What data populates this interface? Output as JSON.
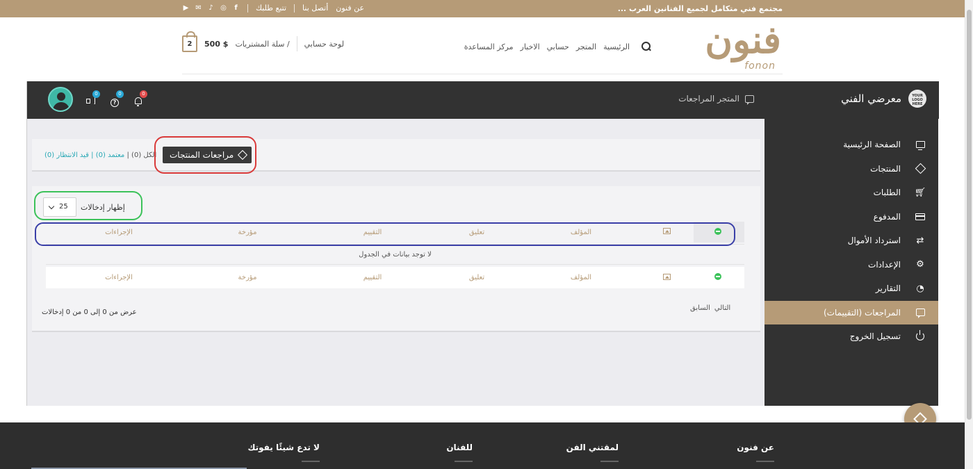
{
  "topbar": {
    "tagline": "مجتمع فني متكامل لجميع الفنانين العرب ...",
    "about": "عن فنون",
    "contact": "أتصل بنا",
    "track": "تتبع طلبك",
    "social_icons": [
      "youtube-icon",
      "mail-icon",
      "tiktok-icon",
      "instagram-icon",
      "facebook-icon"
    ],
    "social_glyphs": [
      "▶",
      "✉",
      "♪",
      "◎",
      "f"
    ]
  },
  "header": {
    "logo_ar": "فنون",
    "logo_en": "fonon",
    "nav": [
      "الرئيسية",
      "المتجر",
      "حسابي",
      "الاخبار",
      "مركز المساعدة"
    ],
    "dashboard_link": "لوحة حسابي",
    "cart_label": "سلة المشتريات /",
    "cart_total": "500 $",
    "cart_count": "2"
  },
  "dashboard": {
    "brand": "معرضي الفني",
    "brand_logo_text": "YOUR LOGO HERE",
    "bar_title": "المتجر المراجعات",
    "badges": {
      "notifications": "0",
      "help": "0",
      "announcements": "0"
    },
    "sidebar": [
      {
        "label": "الصفحة الرئيسية",
        "icon": "monitor-icon"
      },
      {
        "label": "المنتجات",
        "icon": "box-icon"
      },
      {
        "label": "الطلبات",
        "icon": "cart-icon"
      },
      {
        "label": "المدفوع",
        "icon": "card-icon"
      },
      {
        "label": "استرداد الأموال",
        "icon": "refund-icon"
      },
      {
        "label": "الإعدادات",
        "icon": "settings-icon"
      },
      {
        "label": "التقارير",
        "icon": "chart-icon"
      },
      {
        "label": "المراجعات (التقييمات)",
        "icon": "chat-icon"
      },
      {
        "label": "تسجيل الخروج",
        "icon": "power-icon"
      }
    ],
    "active_index": 7
  },
  "reviews": {
    "tab_label": "مراجعات المنتجات",
    "filter_all": "الكل (0) |",
    "filter_approved": "معتمد (0)",
    "filter_sep": "|",
    "filter_pending": "قيد الانتظار (0)",
    "show_label": "إظهار إدخالات",
    "page_size": "25",
    "columns": {
      "author": "المؤلف",
      "comment": "تعليق",
      "rating": "التقييم",
      "date": "مؤرخة",
      "actions": "الإجراءات"
    },
    "empty_message": "لا توجد بيانات في الجدول",
    "info": "عرض من 0 إلى 0 من 0 إدخالات",
    "prev": "السابق",
    "next": "التالي"
  },
  "footer": {
    "cols": [
      "عن فنون",
      "لمقتني الفن",
      "للفنان",
      "لا تدع شيئًا يفوتك"
    ]
  },
  "colors": {
    "accent": "#b69b77",
    "dark": "#323232",
    "teal": "#29a8b5"
  }
}
